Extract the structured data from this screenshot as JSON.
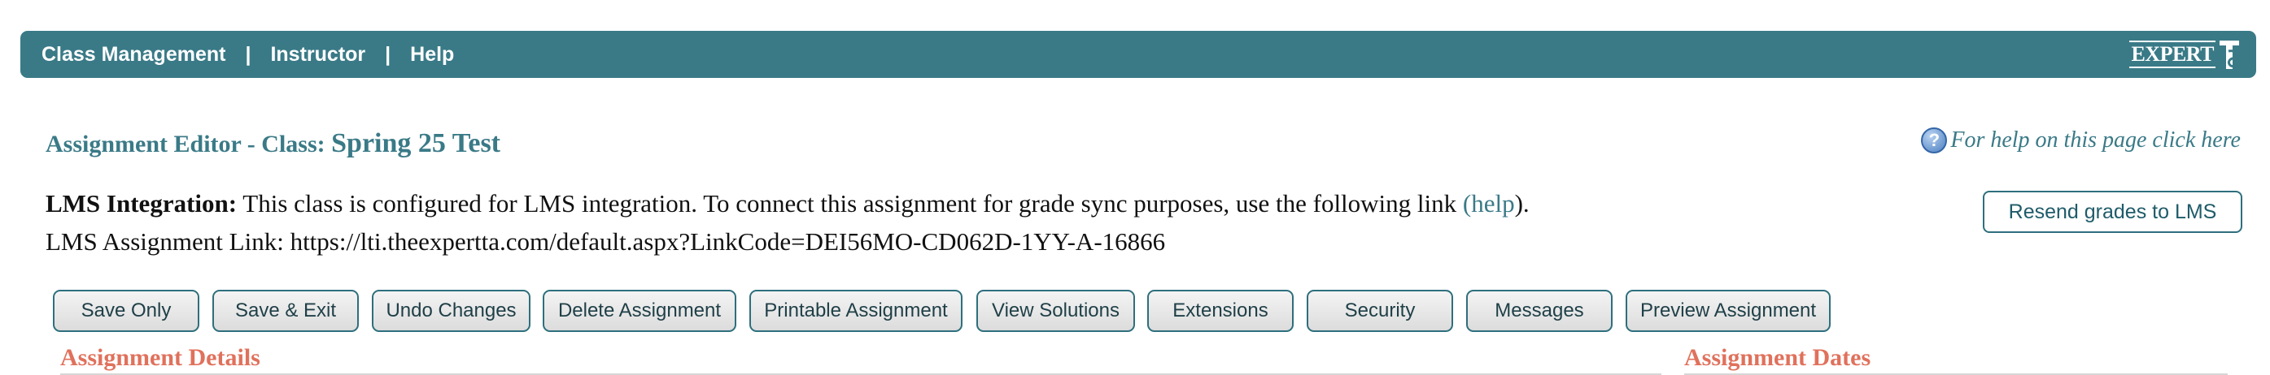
{
  "topbar": {
    "nav": [
      {
        "label": "Class Management"
      },
      {
        "label": "Instructor"
      },
      {
        "label": "Help"
      }
    ],
    "separator": "|",
    "logo_text": "EXPERT",
    "color": "#3a7a87"
  },
  "page": {
    "title_prefix": "Assignment Editor - Class: ",
    "class_name": "Spring 25 Test",
    "help_icon": "?",
    "help_text": "For help on this page click here"
  },
  "lms": {
    "label": "LMS Integration:",
    "message": " This class is configured for LMS integration. To connect this assignment for grade sync purposes, use the following link ",
    "help_open": "(",
    "help_link": "help",
    "help_close": ").",
    "link_label": "LMS Assignment Link: ",
    "link_url": "https://lti.theexpertta.com/default.aspx?LinkCode=DEI56MO-CD062D-1YY-A-16866",
    "resend_label": "Resend grades to LMS"
  },
  "toolbar": {
    "buttons": [
      {
        "label": "Save Only"
      },
      {
        "label": "Save & Exit"
      },
      {
        "label": "Undo Changes"
      },
      {
        "label": "Delete Assignment"
      },
      {
        "label": "Printable Assignment"
      },
      {
        "label": "View Solutions"
      },
      {
        "label": "Extensions"
      },
      {
        "label": "Security"
      },
      {
        "label": "Messages"
      },
      {
        "label": "Preview Assignment"
      }
    ]
  },
  "sections": {
    "details": "Assignment Details",
    "dates": "Assignment Dates",
    "accent_color": "#e0715c"
  }
}
